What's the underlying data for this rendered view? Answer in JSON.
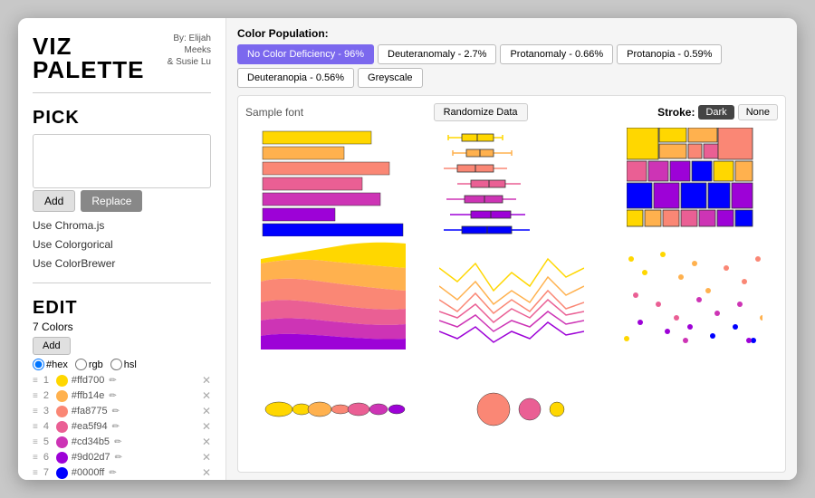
{
  "brand": {
    "title": "VIZ PALETTE",
    "by_line": "By: Elijah Meeks",
    "and_line": "& Susie Lu"
  },
  "pick": {
    "section_title": "PICK",
    "add_label": "Add",
    "replace_label": "Replace",
    "use_chroma": "Use Chroma.js",
    "use_colorgorical": "Use Colorgorical",
    "use_colorbrewer": "Use ColorBrewer"
  },
  "edit": {
    "section_title": "EDIT",
    "colors_count": "7 Colors",
    "add_label": "Add",
    "format_options": [
      "#hex",
      "rgb",
      "hsl"
    ],
    "colors": [
      {
        "num": 1,
        "hex": "#ffd700",
        "swatch": "#ffd700"
      },
      {
        "num": 2,
        "hex": "#ffb14e",
        "swatch": "#ffb14e"
      },
      {
        "num": 3,
        "hex": "#fa8775",
        "swatch": "#fa8775"
      },
      {
        "num": 4,
        "hex": "#ea5f94",
        "swatch": "#ea5f94"
      },
      {
        "num": 5,
        "hex": "#cd34b5",
        "swatch": "#cd34b5"
      },
      {
        "num": 6,
        "hex": "#9d02d7",
        "swatch": "#9d02d7"
      },
      {
        "num": 7,
        "hex": "#0000ff",
        "swatch": "#0000ff"
      }
    ]
  },
  "color_population": {
    "label": "Color Population:",
    "tabs": [
      {
        "id": "no-deficiency",
        "label": "No Color Deficiency - 96%",
        "active": true
      },
      {
        "id": "deuteranomaly",
        "label": "Deuteranomaly - 2.7%",
        "active": false
      },
      {
        "id": "protanomaly",
        "label": "Protanomaly - 0.66%",
        "active": false
      },
      {
        "id": "protanopia",
        "label": "Protanopia - 0.59%",
        "active": false
      },
      {
        "id": "deuteranopia",
        "label": "Deuteranopia - 0.56%",
        "active": false
      },
      {
        "id": "greyscale",
        "label": "Greyscale",
        "active": false
      }
    ]
  },
  "viz": {
    "sample_font": "Sample font",
    "randomize": "Randomize Data",
    "stroke_label": "Stroke:",
    "stroke_dark": "Dark",
    "stroke_none": "None"
  },
  "palette": [
    "#ffd700",
    "#ffb14e",
    "#fa8775",
    "#ea5f94",
    "#cd34b5",
    "#9d02d7",
    "#0000ff"
  ]
}
